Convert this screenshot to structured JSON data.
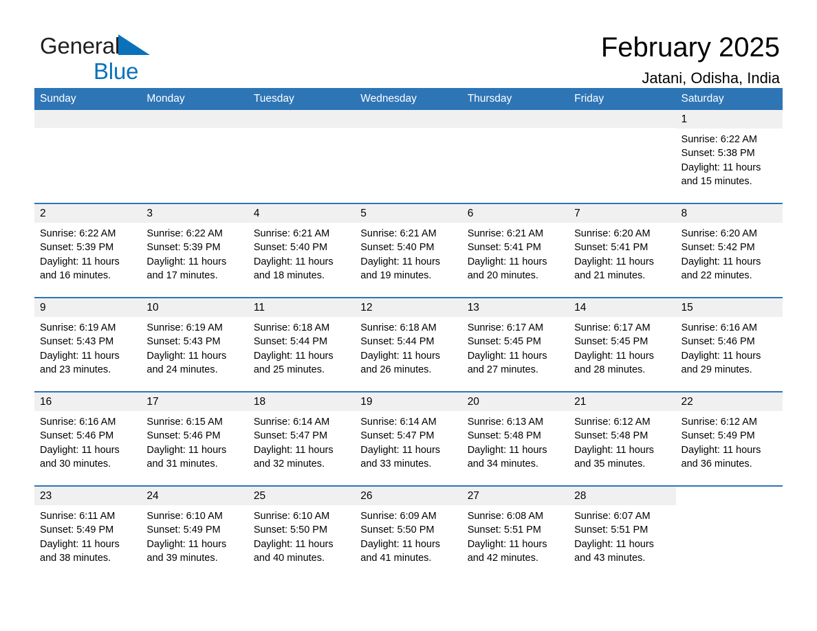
{
  "brand": {
    "name_part1": "General",
    "name_part2": "Blue",
    "logo_icon": "blue-triangle-logo"
  },
  "header": {
    "title": "February 2025",
    "location": "Jatani, Odisha, India"
  },
  "colors": {
    "header_blue": "#2e75b6",
    "brand_blue": "#0b72b9",
    "daynum_band": "#f0f0f0",
    "cell_background": "#ffffff",
    "text": "#000000"
  },
  "calendar": {
    "weekday_headers": [
      "Sunday",
      "Monday",
      "Tuesday",
      "Wednesday",
      "Thursday",
      "Friday",
      "Saturday"
    ],
    "weeks": [
      [
        {
          "day": "",
          "lines": []
        },
        {
          "day": "",
          "lines": []
        },
        {
          "day": "",
          "lines": []
        },
        {
          "day": "",
          "lines": []
        },
        {
          "day": "",
          "lines": []
        },
        {
          "day": "",
          "lines": []
        },
        {
          "day": "1",
          "lines": [
            "Sunrise: 6:22 AM",
            "Sunset: 5:38 PM",
            "Daylight: 11 hours",
            "and 15 minutes."
          ]
        }
      ],
      [
        {
          "day": "2",
          "lines": [
            "Sunrise: 6:22 AM",
            "Sunset: 5:39 PM",
            "Daylight: 11 hours",
            "and 16 minutes."
          ]
        },
        {
          "day": "3",
          "lines": [
            "Sunrise: 6:22 AM",
            "Sunset: 5:39 PM",
            "Daylight: 11 hours",
            "and 17 minutes."
          ]
        },
        {
          "day": "4",
          "lines": [
            "Sunrise: 6:21 AM",
            "Sunset: 5:40 PM",
            "Daylight: 11 hours",
            "and 18 minutes."
          ]
        },
        {
          "day": "5",
          "lines": [
            "Sunrise: 6:21 AM",
            "Sunset: 5:40 PM",
            "Daylight: 11 hours",
            "and 19 minutes."
          ]
        },
        {
          "day": "6",
          "lines": [
            "Sunrise: 6:21 AM",
            "Sunset: 5:41 PM",
            "Daylight: 11 hours",
            "and 20 minutes."
          ]
        },
        {
          "day": "7",
          "lines": [
            "Sunrise: 6:20 AM",
            "Sunset: 5:41 PM",
            "Daylight: 11 hours",
            "and 21 minutes."
          ]
        },
        {
          "day": "8",
          "lines": [
            "Sunrise: 6:20 AM",
            "Sunset: 5:42 PM",
            "Daylight: 11 hours",
            "and 22 minutes."
          ]
        }
      ],
      [
        {
          "day": "9",
          "lines": [
            "Sunrise: 6:19 AM",
            "Sunset: 5:43 PM",
            "Daylight: 11 hours",
            "and 23 minutes."
          ]
        },
        {
          "day": "10",
          "lines": [
            "Sunrise: 6:19 AM",
            "Sunset: 5:43 PM",
            "Daylight: 11 hours",
            "and 24 minutes."
          ]
        },
        {
          "day": "11",
          "lines": [
            "Sunrise: 6:18 AM",
            "Sunset: 5:44 PM",
            "Daylight: 11 hours",
            "and 25 minutes."
          ]
        },
        {
          "day": "12",
          "lines": [
            "Sunrise: 6:18 AM",
            "Sunset: 5:44 PM",
            "Daylight: 11 hours",
            "and 26 minutes."
          ]
        },
        {
          "day": "13",
          "lines": [
            "Sunrise: 6:17 AM",
            "Sunset: 5:45 PM",
            "Daylight: 11 hours",
            "and 27 minutes."
          ]
        },
        {
          "day": "14",
          "lines": [
            "Sunrise: 6:17 AM",
            "Sunset: 5:45 PM",
            "Daylight: 11 hours",
            "and 28 minutes."
          ]
        },
        {
          "day": "15",
          "lines": [
            "Sunrise: 6:16 AM",
            "Sunset: 5:46 PM",
            "Daylight: 11 hours",
            "and 29 minutes."
          ]
        }
      ],
      [
        {
          "day": "16",
          "lines": [
            "Sunrise: 6:16 AM",
            "Sunset: 5:46 PM",
            "Daylight: 11 hours",
            "and 30 minutes."
          ]
        },
        {
          "day": "17",
          "lines": [
            "Sunrise: 6:15 AM",
            "Sunset: 5:46 PM",
            "Daylight: 11 hours",
            "and 31 minutes."
          ]
        },
        {
          "day": "18",
          "lines": [
            "Sunrise: 6:14 AM",
            "Sunset: 5:47 PM",
            "Daylight: 11 hours",
            "and 32 minutes."
          ]
        },
        {
          "day": "19",
          "lines": [
            "Sunrise: 6:14 AM",
            "Sunset: 5:47 PM",
            "Daylight: 11 hours",
            "and 33 minutes."
          ]
        },
        {
          "day": "20",
          "lines": [
            "Sunrise: 6:13 AM",
            "Sunset: 5:48 PM",
            "Daylight: 11 hours",
            "and 34 minutes."
          ]
        },
        {
          "day": "21",
          "lines": [
            "Sunrise: 6:12 AM",
            "Sunset: 5:48 PM",
            "Daylight: 11 hours",
            "and 35 minutes."
          ]
        },
        {
          "day": "22",
          "lines": [
            "Sunrise: 6:12 AM",
            "Sunset: 5:49 PM",
            "Daylight: 11 hours",
            "and 36 minutes."
          ]
        }
      ],
      [
        {
          "day": "23",
          "lines": [
            "Sunrise: 6:11 AM",
            "Sunset: 5:49 PM",
            "Daylight: 11 hours",
            "and 38 minutes."
          ]
        },
        {
          "day": "24",
          "lines": [
            "Sunrise: 6:10 AM",
            "Sunset: 5:49 PM",
            "Daylight: 11 hours",
            "and 39 minutes."
          ]
        },
        {
          "day": "25",
          "lines": [
            "Sunrise: 6:10 AM",
            "Sunset: 5:50 PM",
            "Daylight: 11 hours",
            "and 40 minutes."
          ]
        },
        {
          "day": "26",
          "lines": [
            "Sunrise: 6:09 AM",
            "Sunset: 5:50 PM",
            "Daylight: 11 hours",
            "and 41 minutes."
          ]
        },
        {
          "day": "27",
          "lines": [
            "Sunrise: 6:08 AM",
            "Sunset: 5:51 PM",
            "Daylight: 11 hours",
            "and 42 minutes."
          ]
        },
        {
          "day": "28",
          "lines": [
            "Sunrise: 6:07 AM",
            "Sunset: 5:51 PM",
            "Daylight: 11 hours",
            "and 43 minutes."
          ]
        },
        {
          "day": "",
          "lines": []
        }
      ]
    ]
  }
}
